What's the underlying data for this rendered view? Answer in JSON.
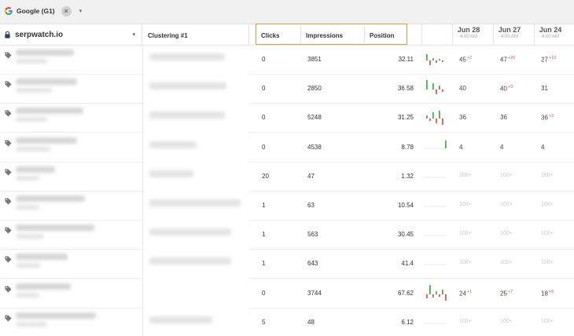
{
  "topbar": {
    "engine_label": "Google (G1)"
  },
  "header": {
    "site": "serpwatch.io",
    "clustering": "Clustering #1",
    "clicks": "Clicks",
    "impressions": "Impressions",
    "position": "Position",
    "dates": [
      {
        "day": "Jun 28",
        "time": "4:00 AM"
      },
      {
        "day": "Jun 27",
        "time": "4:00 AM"
      },
      {
        "day": "Jun 24",
        "time": "4:00 AM"
      }
    ]
  },
  "colors": {
    "highlight_border": "#e39b3c",
    "up": "#4caf50",
    "down": "#e05757"
  },
  "rows": [
    {
      "clicks": "0",
      "impressions": "3851",
      "position": "32.11",
      "ranks": [
        {
          "v": "45",
          "ch": "+2",
          "dir": "up"
        },
        {
          "v": "47",
          "ch": "+20",
          "dir": "dn"
        },
        {
          "v": "27",
          "ch": "+10",
          "dir": "dn"
        }
      ]
    },
    {
      "clicks": "0",
      "impressions": "2850",
      "position": "36.58",
      "ranks": [
        {
          "v": "40",
          "ch": "",
          "dir": ""
        },
        {
          "v": "40",
          "ch": "+9",
          "dir": "dn"
        },
        {
          "v": "31",
          "ch": "",
          "dir": ""
        }
      ]
    },
    {
      "clicks": "0",
      "impressions": "5248",
      "position": "31.25",
      "ranks": [
        {
          "v": "36",
          "ch": "",
          "dir": ""
        },
        {
          "v": "36",
          "ch": "",
          "dir": ""
        },
        {
          "v": "36",
          "ch": "+3",
          "dir": "dn"
        }
      ]
    },
    {
      "clicks": "0",
      "impressions": "4538",
      "position": "8.78",
      "ranks": [
        {
          "v": "4",
          "ch": "",
          "dir": ""
        },
        {
          "v": "4",
          "ch": "",
          "dir": ""
        },
        {
          "v": "4",
          "ch": "",
          "dir": ""
        }
      ]
    },
    {
      "clicks": "20",
      "impressions": "47",
      "position": "1.32",
      "ranks": [
        {
          "v": "100+",
          "ch": "",
          "dir": "muted"
        },
        {
          "v": "100+",
          "ch": "",
          "dir": "muted"
        },
        {
          "v": "100+",
          "ch": "",
          "dir": "muted"
        }
      ]
    },
    {
      "clicks": "1",
      "impressions": "63",
      "position": "10.54",
      "ranks": [
        {
          "v": "100+",
          "ch": "",
          "dir": "muted"
        },
        {
          "v": "100+",
          "ch": "",
          "dir": "muted"
        },
        {
          "v": "100+",
          "ch": "",
          "dir": "muted"
        }
      ]
    },
    {
      "clicks": "1",
      "impressions": "563",
      "position": "30.45",
      "ranks": [
        {
          "v": "100+",
          "ch": "",
          "dir": "muted"
        },
        {
          "v": "100+",
          "ch": "",
          "dir": "muted"
        },
        {
          "v": "100+",
          "ch": "",
          "dir": "muted"
        }
      ]
    },
    {
      "clicks": "1",
      "impressions": "643",
      "position": "41.4",
      "ranks": [
        {
          "v": "100+",
          "ch": "",
          "dir": "muted"
        },
        {
          "v": "100+",
          "ch": "",
          "dir": "muted"
        },
        {
          "v": "100+",
          "ch": "",
          "dir": "muted"
        }
      ]
    },
    {
      "clicks": "0",
      "impressions": "3744",
      "position": "67.62",
      "ranks": [
        {
          "v": "24",
          "ch": "+1",
          "dir": "up"
        },
        {
          "v": "25",
          "ch": "+7",
          "dir": "up"
        },
        {
          "v": "18",
          "ch": "+9",
          "dir": "dn"
        }
      ]
    },
    {
      "clicks": "5",
      "impressions": "48",
      "position": "6.12",
      "ranks": [
        {
          "v": "100+",
          "ch": "",
          "dir": "muted"
        },
        {
          "v": "100+",
          "ch": "",
          "dir": "muted"
        },
        {
          "v": "100+",
          "ch": "",
          "dir": "muted"
        }
      ]
    }
  ]
}
